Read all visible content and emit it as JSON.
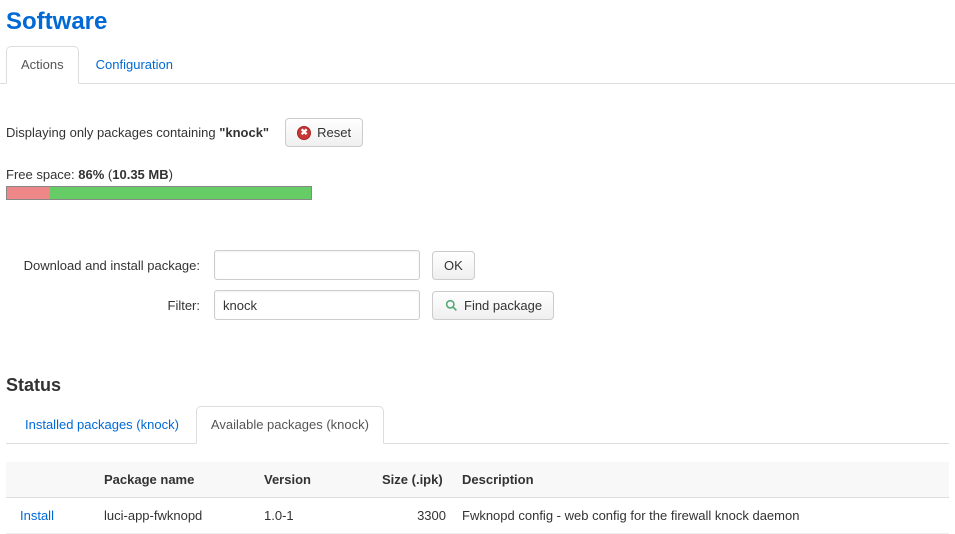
{
  "page_title": "Software",
  "top_tabs": {
    "actions": "Actions",
    "configuration": "Configuration"
  },
  "filter_notice": {
    "prefix": "Displaying only packages containing ",
    "term_quoted": "\"knock\"",
    "reset_label": "Reset"
  },
  "freespace": {
    "prefix": "Free space: ",
    "pct": "86%",
    "size": "10.35 MB",
    "used_pct": 14,
    "free_pct": 86
  },
  "forms": {
    "install_label": "Download and install package:",
    "install_value": "",
    "ok_label": "OK",
    "filter_label": "Filter:",
    "filter_value": "knock",
    "find_label": "Find package"
  },
  "status": {
    "heading": "Status",
    "tabs": {
      "installed": "Installed packages (knock)",
      "available": "Available packages (knock)"
    }
  },
  "table": {
    "headers": {
      "action": "",
      "name": "Package name",
      "version": "Version",
      "size": "Size (.ipk)",
      "description": "Description"
    },
    "rows": [
      {
        "action": "Install",
        "name": "luci-app-fwknopd",
        "version": "1.0-1",
        "size": "3300",
        "description": "Fwknopd config - web config for the firewall knock daemon"
      }
    ]
  }
}
